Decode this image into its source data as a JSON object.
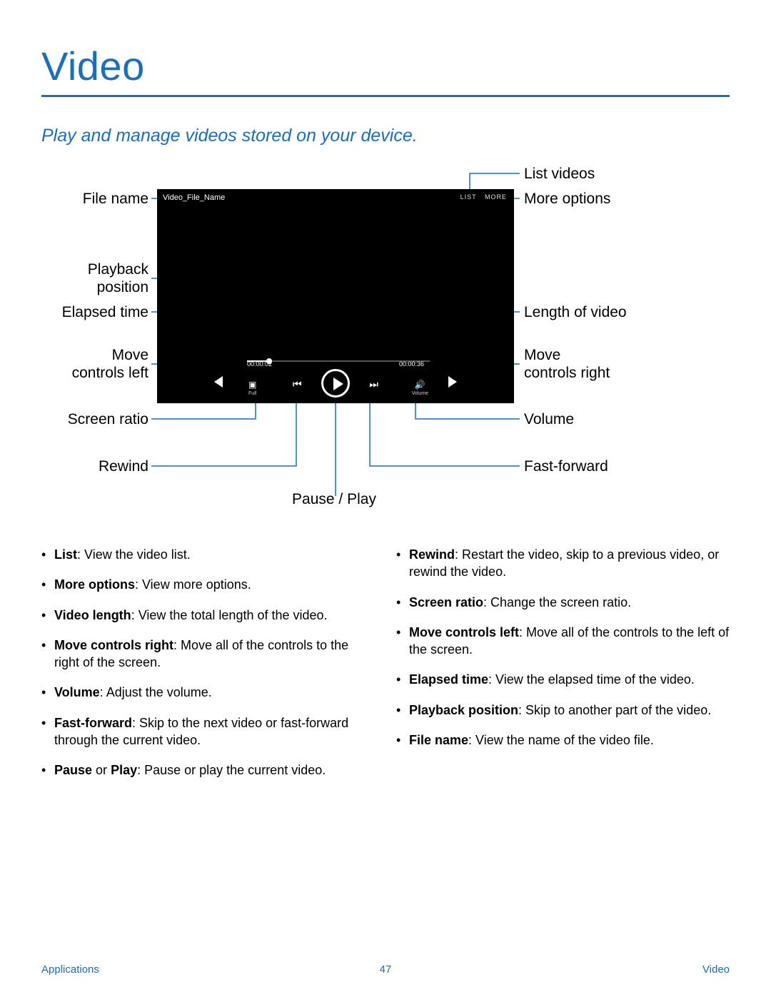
{
  "title": "Video",
  "subtitle": "Play and manage videos stored on your device.",
  "player": {
    "file_name_display": "Video_File_Name",
    "list_label": "LIST",
    "more_label": "MORE",
    "elapsed": "00:00:02",
    "length": "00:00:36",
    "full_label": "Full",
    "volume_label": "Volume"
  },
  "callouts": {
    "file_name": "File name",
    "playback_position_l1": "Playback",
    "playback_position_l2": "position",
    "elapsed_time": "Elapsed time",
    "move_left_l1": "Move",
    "move_left_l2": "controls left",
    "screen_ratio": "Screen ratio",
    "rewind": "Rewind",
    "pause_play": "Pause / Play",
    "list_videos": "List videos",
    "more_options": "More options",
    "length_of_video": "Length of video",
    "move_right_l1": "Move",
    "move_right_l2": "controls right",
    "volume": "Volume",
    "fast_forward": "Fast-forward"
  },
  "bullets_left": [
    {
      "term": "List",
      "desc": ": View the video list."
    },
    {
      "term": "More options",
      "desc": ": View more options."
    },
    {
      "term": "Video length",
      "desc": ": View the total length of the video."
    },
    {
      "term": "Move controls right",
      "desc": ": Move all of the controls to the right of the screen."
    },
    {
      "term": "Volume",
      "desc": ": Adjust the volume."
    },
    {
      "term": "Fast-forward",
      "desc": ": Skip to the next video or fast-forward through the current video."
    },
    {
      "term": "Pause",
      "term2": "Play",
      "joiner": " or ",
      "desc": ": Pause or play the current video."
    }
  ],
  "bullets_right": [
    {
      "term": "Rewind",
      "desc": ": Restart the video, skip to a previous video, or rewind the video."
    },
    {
      "term": "Screen ratio",
      "desc": ": Change the screen ratio."
    },
    {
      "term": "Move controls left",
      "desc": ": Move all of the controls to the left of the screen."
    },
    {
      "term": "Elapsed time",
      "desc": ": View the elapsed time of the video."
    },
    {
      "term": "Playback position",
      "desc": ": Skip to another part of the video."
    },
    {
      "term": "File name",
      "desc": ": View the name of the video file."
    }
  ],
  "footer": {
    "left": "Applications",
    "center": "47",
    "right": "Video"
  }
}
